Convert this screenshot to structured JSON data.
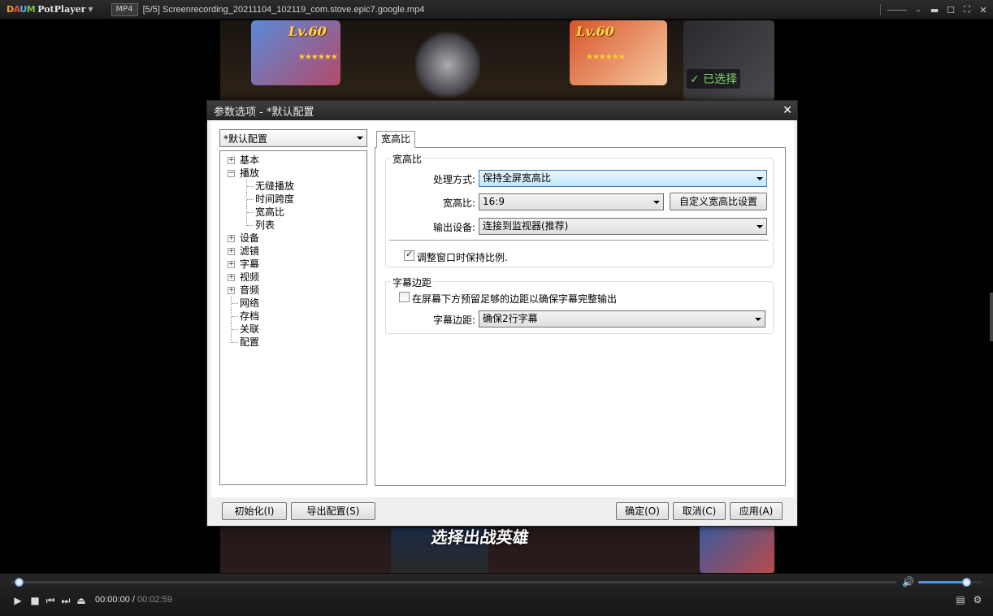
{
  "player": {
    "logo_letters": [
      "D",
      "A",
      "U",
      "M"
    ],
    "app_name": "PotPlayer",
    "format": "MP4",
    "file_title": "[5/5] Screenrecording_20211104_102119_com.stove.epic7.google.mp4"
  },
  "video": {
    "level_left": "Lv.60",
    "level_right": "Lv.60",
    "selected_label": "✓ 已选择",
    "pick_hero_label": "选择出战英雄"
  },
  "dialog": {
    "title": "参数选项 - *默认配置",
    "profile_value": "*默认配置",
    "tree": [
      {
        "label": "基本",
        "expandable": true,
        "level": 0
      },
      {
        "label": "播放",
        "expandable": true,
        "expanded": true,
        "level": 0
      },
      {
        "label": "无缝播放",
        "level": 1
      },
      {
        "label": "时间跨度",
        "level": 1
      },
      {
        "label": "宽高比",
        "level": 1,
        "selected": true
      },
      {
        "label": "列表",
        "level": 1
      },
      {
        "label": "设备",
        "expandable": true,
        "level": 0
      },
      {
        "label": "滤镜",
        "expandable": true,
        "level": 0
      },
      {
        "label": "字幕",
        "expandable": true,
        "level": 0
      },
      {
        "label": "视频",
        "expandable": true,
        "level": 0
      },
      {
        "label": "音频",
        "expandable": true,
        "level": 0
      },
      {
        "label": "网络",
        "level": 0
      },
      {
        "label": "存档",
        "level": 0
      },
      {
        "label": "关联",
        "level": 0
      },
      {
        "label": "配置",
        "level": 0
      }
    ],
    "tab_label": "宽高比",
    "aspect_group": {
      "title": "宽高比",
      "method_label": "处理方式:",
      "method_value": "保持全屏宽高比",
      "ratio_label": "宽高比:",
      "ratio_value": "16:9",
      "custom_button": "自定义宽高比设置",
      "output_label": "输出设备:",
      "output_value": "连接到监视器(推荐)",
      "keep_ratio_label": "调整窗口时保持比例.",
      "keep_ratio_checked": true
    },
    "subtitle_group": {
      "title": "字幕边距",
      "reserve_label": "在屏幕下方预留足够的边距以确保字幕完整输出",
      "reserve_checked": false,
      "margin_label": "字幕边距:",
      "margin_value": "确保2行字幕"
    },
    "footer": {
      "reset": "初始化(I)",
      "export": "导出配置(S)",
      "ok": "确定(O)",
      "cancel": "取消(C)",
      "apply": "应用(A)"
    }
  },
  "controls": {
    "current_time": "00:00:00",
    "separator": " / ",
    "duration": "00:02:59",
    "seek_progress": 0.01,
    "volume_level": 0.75,
    "accent_color": "#4d8fe0"
  }
}
